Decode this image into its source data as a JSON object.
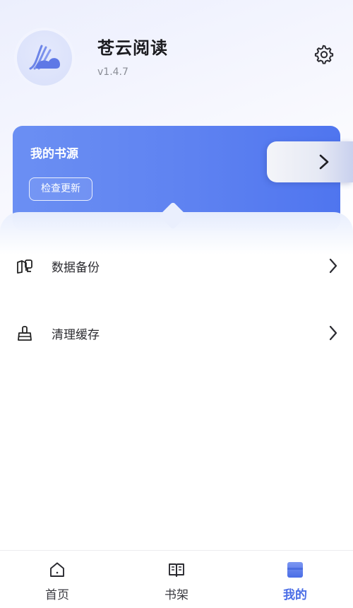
{
  "header": {
    "app_name": "苍云阅读",
    "version": "v1.4.7",
    "avatar_icon": "app-logo-icon",
    "settings_icon": "gear-icon"
  },
  "source_card": {
    "title": "我的书源",
    "check_update_label": "检查更新",
    "arrow_icon": "chevron-right-icon",
    "accent_color": "#5e82f1"
  },
  "menu": {
    "items": [
      {
        "label": "数据备份",
        "icon": "backup-icon"
      },
      {
        "label": "清理缓存",
        "icon": "broom-icon"
      }
    ]
  },
  "bottom_nav": {
    "items": [
      {
        "label": "首页",
        "icon": "home-icon",
        "active": false
      },
      {
        "label": "书架",
        "icon": "book-icon",
        "active": false
      },
      {
        "label": "我的",
        "icon": "profile-icon",
        "active": true
      }
    ],
    "active_color": "#4a6de6"
  }
}
